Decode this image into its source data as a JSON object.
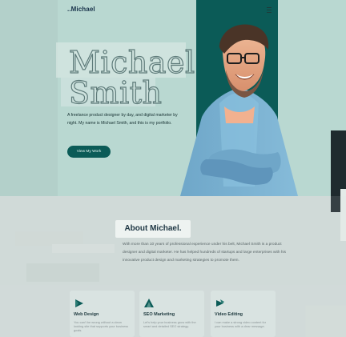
{
  "site": {
    "logo": "..Michael",
    "menu_icon": "menu-icon"
  },
  "hero": {
    "name_first": "Michael",
    "name_last": "Smith",
    "intro": "A freelance product designer by day, and digital marketer by night. My name is Michael Smith, and this is my portfolio.",
    "cta_label": "View My Work"
  },
  "about": {
    "title": "About Michael.",
    "text": "With more than 10 years of professional experience under his belt, Michael Smith is a product designer and digital marketer. He has helped hundreds of startups and large enterprises with his innovative product design and marketing strategies to promote them."
  },
  "services": [
    {
      "title": "Web Design",
      "icon": "web-design-icon",
      "text": "You can't be wrong without a clean looking site that supports your business goals."
    },
    {
      "title": "SEO Marketing",
      "icon": "seo-marketing-icon",
      "text": "Let's help your business grow with the smart and detailed SEO strategy."
    },
    {
      "title": "Video Editing",
      "icon": "video-editing-icon",
      "text": "I can make a strong video content for your business with a clear message."
    }
  ],
  "colors": {
    "hero_bg": "#b9d8d1",
    "accent_teal": "#0b5b57",
    "page_bg": "#cfd9d6",
    "text_dark": "#183233"
  }
}
